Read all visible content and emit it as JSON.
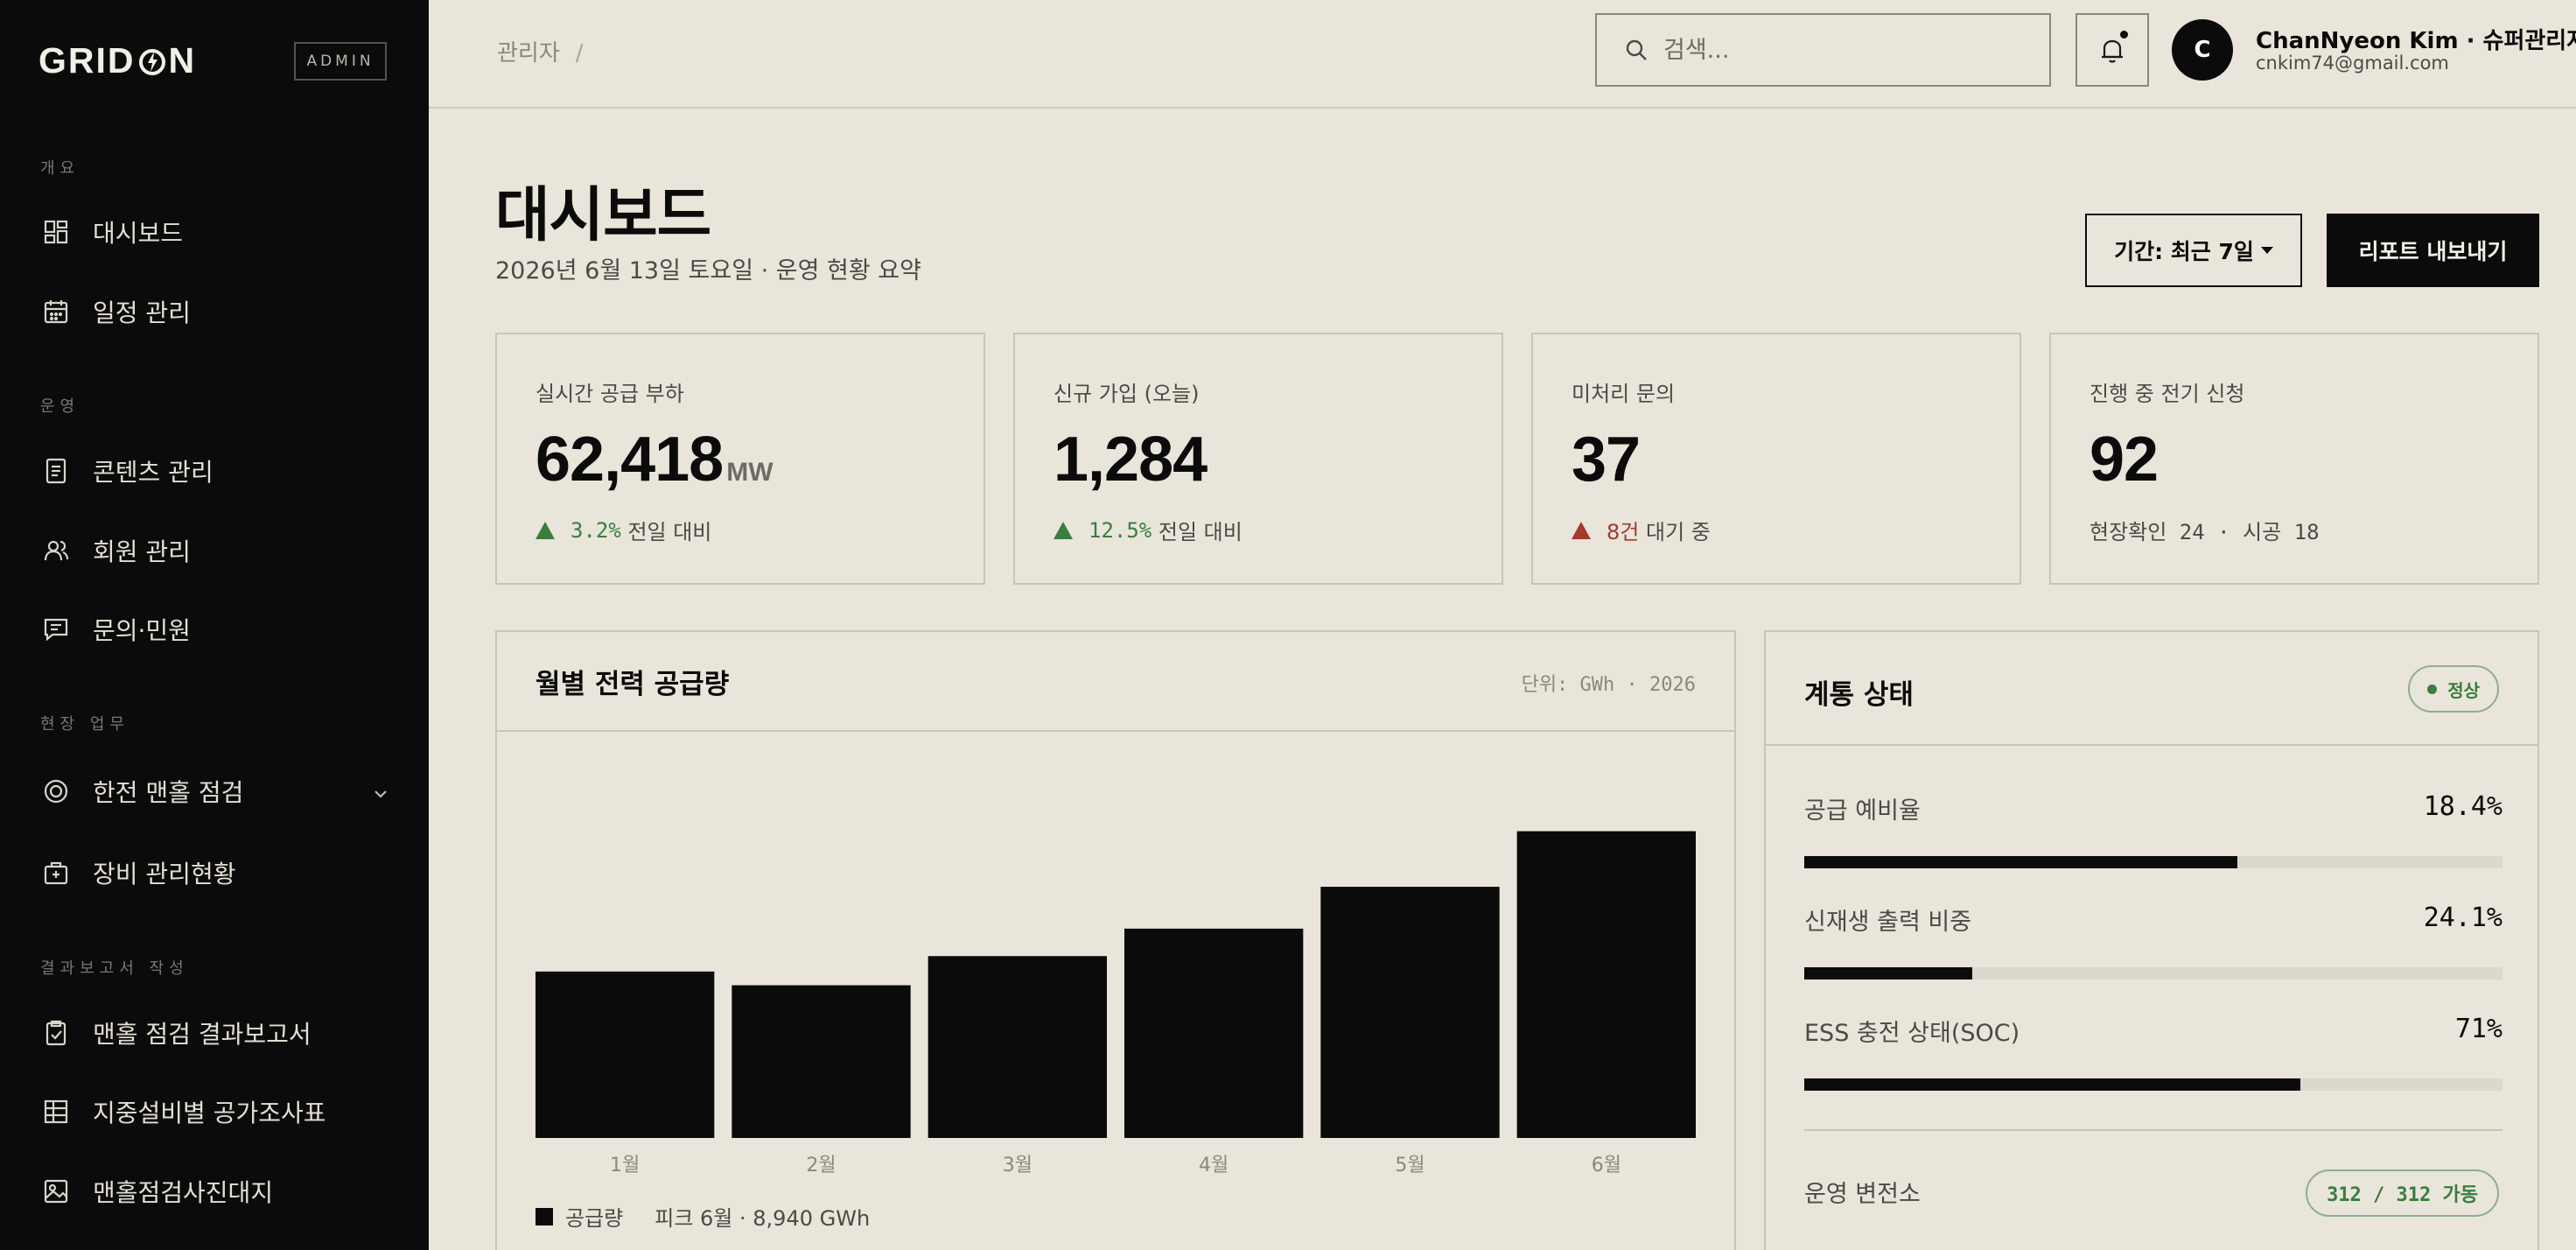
{
  "brand": {
    "logo_left": "GRID",
    "logo_right": "N",
    "badge": "ADMIN"
  },
  "sidebar": {
    "sections": [
      {
        "label": "개요",
        "items": [
          {
            "label": "대시보드",
            "icon": "dashboard-grid-icon"
          },
          {
            "label": "일정 관리",
            "icon": "calendar-icon"
          }
        ]
      },
      {
        "label": "운영",
        "items": [
          {
            "label": "콘텐츠 관리",
            "icon": "document-icon"
          },
          {
            "label": "회원 관리",
            "icon": "users-icon"
          },
          {
            "label": "문의·민원",
            "icon": "message-icon"
          }
        ]
      },
      {
        "label": "현장 업무",
        "items": [
          {
            "label": "한전 맨홀 점검",
            "icon": "target-icon",
            "expandable": true
          },
          {
            "label": "장비 관리현황",
            "icon": "toolbox-icon"
          }
        ]
      },
      {
        "label": "결과보고서 작성",
        "items": [
          {
            "label": "맨홀 점검 결과보고서",
            "icon": "clipboard-icon"
          },
          {
            "label": "지중설비별 공가조사표",
            "icon": "table-icon"
          },
          {
            "label": "맨홀점검사진대지",
            "icon": "image-icon"
          }
        ]
      }
    ]
  },
  "topbar": {
    "breadcrumb": "관리자",
    "breadcrumb_sep": "/",
    "search_placeholder": "검색...",
    "user": {
      "initial": "C",
      "name": "ChanNyeon Kim · 슈퍼관리자",
      "email": "cnkim74@gmail.com"
    }
  },
  "header": {
    "title": "대시보드",
    "subtitle": "2026년 6월 13일 토요일 · 운영 현황 요약",
    "period_button": "기간: 최근 7일",
    "export_button": "리포트 내보내기"
  },
  "kpis": [
    {
      "label": "실시간 공급 부하",
      "value": "62,418",
      "unit": "MW",
      "delta": "3.2%",
      "delta_text": "전일 대비",
      "trend": "up"
    },
    {
      "label": "신규 가입 (오늘)",
      "value": "1,284",
      "unit": "",
      "delta": "12.5%",
      "delta_text": "전일 대비",
      "trend": "up"
    },
    {
      "label": "미처리 문의",
      "value": "37",
      "unit": "",
      "delta": "8건",
      "delta_text": "대기 중",
      "trend": "warn"
    },
    {
      "label": "진행 중 전기 신청",
      "value": "92",
      "unit": "",
      "delta": "",
      "delta_text": "현장확인 24 · 시공 18",
      "trend": "none"
    }
  ],
  "chart_panel": {
    "title": "월별 전력 공급량",
    "unit_text": "단위: GWh · 2026",
    "legend_label": "공급량",
    "peak_text": "피크 6월 · 8,940 GWh"
  },
  "chart_data": {
    "type": "bar",
    "categories": [
      "1월",
      "2월",
      "3월",
      "4월",
      "5월",
      "6월"
    ],
    "values": [
      4850,
      4450,
      5300,
      6100,
      7320,
      8940
    ],
    "ylim": [
      0,
      10000
    ],
    "grid": false,
    "legend": "bottom-left"
  },
  "grid_status": {
    "title": "계통 상태",
    "badge": "정상",
    "metrics": [
      {
        "label": "공급 예비율",
        "value": "18.4%",
        "fill": 0.62
      },
      {
        "label": "신재생 출력 비중",
        "value": "24.1%",
        "fill": 0.24
      },
      {
        "label": "ESS 충전 상태(SOC)",
        "value": "71%",
        "fill": 0.71
      }
    ],
    "station_label": "운영 변전소",
    "station_badge": "312 / 312 가동"
  },
  "colors": {
    "accent": "#0b0b0b",
    "background": "#e9e5da",
    "positive": "#3a7d3e",
    "warning": "#a33a2c"
  }
}
